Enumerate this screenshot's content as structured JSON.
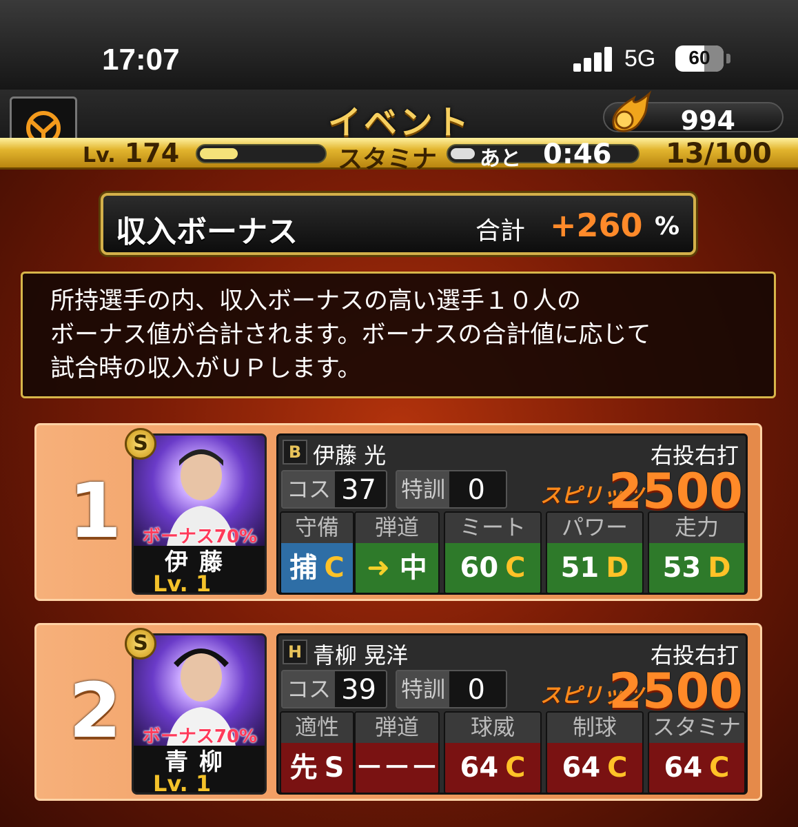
{
  "status_bar": {
    "time": "17:07",
    "network": "5G",
    "battery": "60",
    "battery_level": 0.6
  },
  "header": {
    "title": "イベント",
    "coins": "994"
  },
  "level_bar": {
    "lv_prefix": "Lv.",
    "level": "174",
    "stamina_label": "スタミナ",
    "ato": "あと",
    "timer": "0:46",
    "stamina": "13/100",
    "xp_fraction": 0.3,
    "stamina_fraction": 0.13
  },
  "bonus": {
    "label": "収入ボーナス",
    "total_label": "合計",
    "value": "+260",
    "unit": "%"
  },
  "description": {
    "lines": [
      "所持選手の内、収入ボーナスの高い選手１０人の",
      "ボーナス値が合計されます。ボーナスの合計値に応じて",
      "試合時の収入がＵＰします。"
    ]
  },
  "players": [
    {
      "rank": "1",
      "rarity": "S",
      "team_icon": "B",
      "name": "伊藤 光",
      "short_name": "伊藤",
      "level": "Lv. 1",
      "bonus": "ボーナス70%",
      "hand": "右投右打",
      "cost_label": "コス",
      "cost": "37",
      "training_label": "特訓",
      "training": "0",
      "spirits_label": "スピリッツ",
      "spirits": "2500",
      "stats": [
        {
          "header": "守備",
          "value": "捕",
          "grade": "C"
        },
        {
          "header": "弾道",
          "value": "中",
          "grade": ""
        },
        {
          "header": "ミート",
          "value": "60",
          "grade": "C"
        },
        {
          "header": "パワー",
          "value": "51",
          "grade": "D"
        },
        {
          "header": "走力",
          "value": "53",
          "grade": "D"
        }
      ]
    },
    {
      "rank": "2",
      "rarity": "S",
      "team_icon": "H",
      "name": "青柳 晃洋",
      "short_name": "青柳",
      "level": "Lv. 1",
      "bonus": "ボーナス70%",
      "hand": "右投右打",
      "cost_label": "コス",
      "cost": "39",
      "training_label": "特訓",
      "training": "0",
      "spirits_label": "スピリッツ",
      "spirits": "2500",
      "stats": [
        {
          "header": "適性",
          "value": "先",
          "grade": "S"
        },
        {
          "header": "弾道",
          "value": "－－－",
          "grade": ""
        },
        {
          "header": "球威",
          "value": "64",
          "grade": "C"
        },
        {
          "header": "制球",
          "value": "64",
          "grade": "C"
        },
        {
          "header": "スタミナ",
          "value": "64",
          "grade": "C"
        }
      ]
    }
  ]
}
